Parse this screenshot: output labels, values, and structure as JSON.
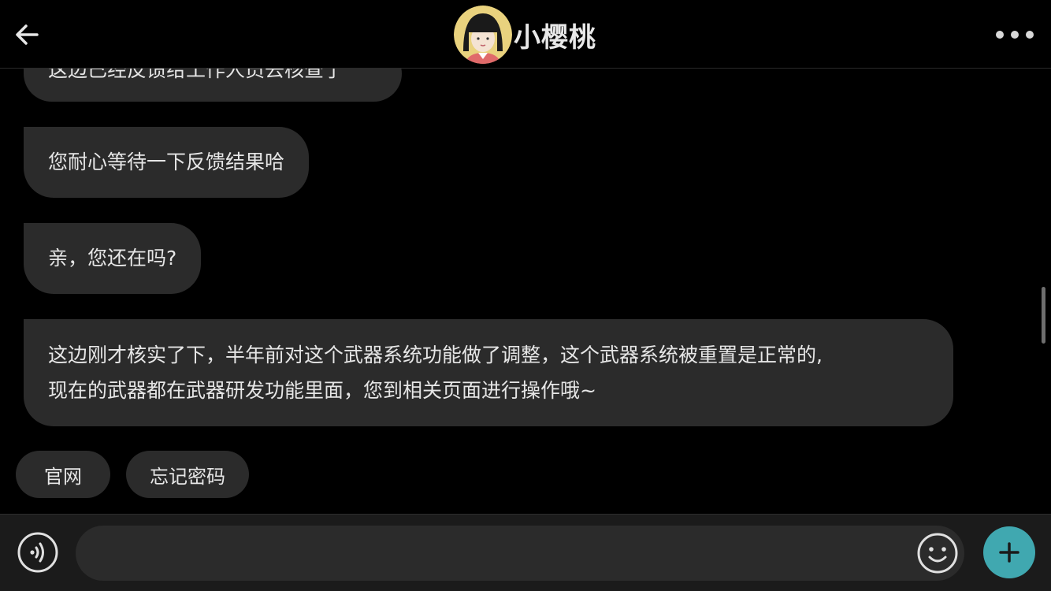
{
  "header": {
    "back_icon": "arrow-left-icon",
    "title": "小樱桃",
    "more_icon": "more-horizontal-icon"
  },
  "messages": [
    {
      "text": "这边已经反馈给工作人员去核查了"
    },
    {
      "text": "您耐心等待一下反馈结果哈"
    },
    {
      "text": "亲，您还在吗?"
    },
    {
      "lines": [
        "这边刚才核实了下，半年前对这个武器系统功能做了调整，这个武器系统被重置是正常的,",
        "现在的武器都在武器研发功能里面，您到相关页面进行操作哦~"
      ]
    }
  ],
  "quick_replies": [
    {
      "label": "官网"
    },
    {
      "label": "忘记密码"
    }
  ],
  "input": {
    "voice_icon": "voice-icon",
    "value": "",
    "placeholder": "",
    "emoji_icon": "smiley-icon",
    "plus_icon": "plus-icon"
  },
  "colors": {
    "background": "#000000",
    "bubble": "#2b2b2b",
    "input_bar": "#1b1b1b",
    "accent": "#40a8b0"
  }
}
